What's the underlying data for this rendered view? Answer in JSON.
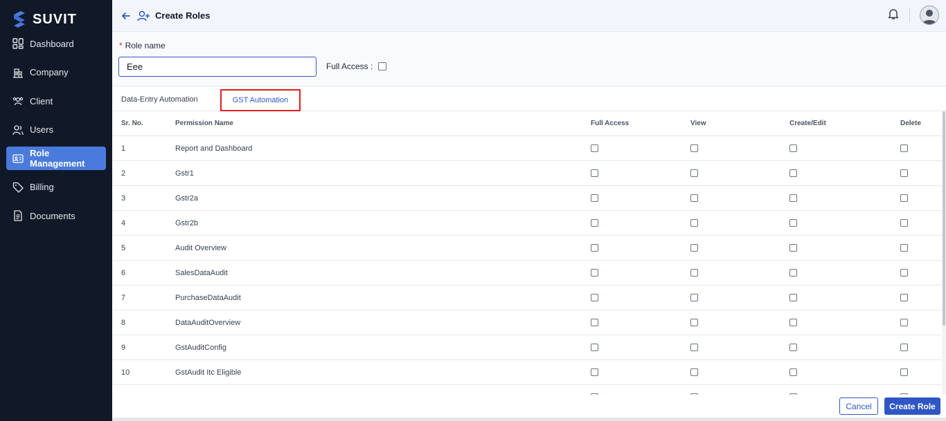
{
  "app": {
    "brand": "SUVIT"
  },
  "sidebar": {
    "items": [
      {
        "label": "Dashboard",
        "icon": "dashboard-grid-icon",
        "active": false
      },
      {
        "label": "Company",
        "icon": "building-icon",
        "active": false
      },
      {
        "label": "Client",
        "icon": "clients-icon",
        "active": false
      },
      {
        "label": "Users",
        "icon": "users-icon",
        "active": false
      },
      {
        "label": "Role Management",
        "icon": "role-card-icon",
        "active": true
      },
      {
        "label": "Billing",
        "icon": "tag-icon",
        "active": false
      },
      {
        "label": "Documents",
        "icon": "document-icon",
        "active": false
      }
    ]
  },
  "header": {
    "title": "Create Roles"
  },
  "form": {
    "role_label": "Role name",
    "required_mark": "*",
    "role_value": "Eee",
    "full_access_label": "Full Access :"
  },
  "tabs": [
    {
      "label": "Data-Entry Automation",
      "active": false
    },
    {
      "label": "GST Automation",
      "active": true
    }
  ],
  "table": {
    "headers": {
      "sr": "Sr. No.",
      "name": "Permission Name",
      "full_access": "Full Access",
      "view": "View",
      "create_edit": "Create/Edit",
      "delete": "Delete"
    },
    "rows": [
      {
        "sr": "1",
        "name": "Report and Dashboard"
      },
      {
        "sr": "2",
        "name": "Gstr1"
      },
      {
        "sr": "3",
        "name": "Gstr2a"
      },
      {
        "sr": "4",
        "name": "Gstr2b"
      },
      {
        "sr": "5",
        "name": "Audit Overview"
      },
      {
        "sr": "6",
        "name": "SalesDataAudit"
      },
      {
        "sr": "7",
        "name": "PurchaseDataAudit"
      },
      {
        "sr": "8",
        "name": "DataAuditOverview"
      },
      {
        "sr": "9",
        "name": "GstAuditConfig"
      },
      {
        "sr": "10",
        "name": "GstAudit Itc Eligible"
      },
      {
        "sr": "",
        "name": ""
      }
    ]
  },
  "footer": {
    "cancel_label": "Cancel",
    "create_label": "Create Role"
  },
  "colors": {
    "sidebar_bg": "#111827",
    "accent": "#2f56c4",
    "active_nav": "#4a7bdc",
    "highlight_border": "#e11d21"
  }
}
